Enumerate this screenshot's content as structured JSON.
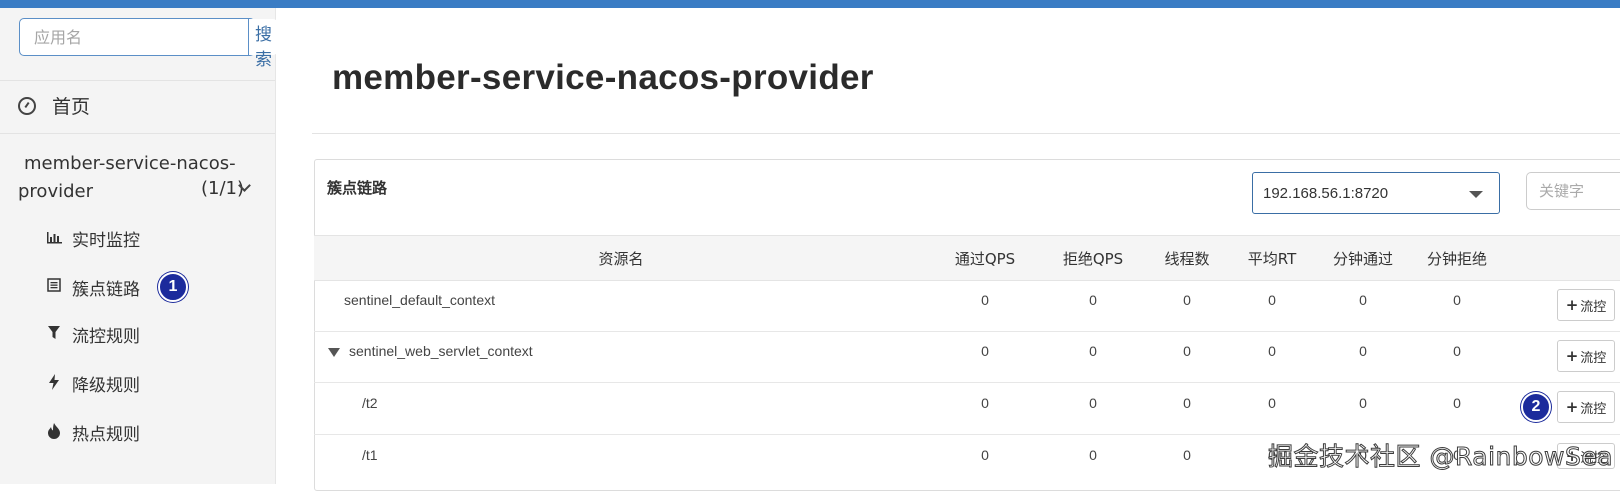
{
  "sidebar": {
    "search": {
      "placeholder": "应用名",
      "button": "搜索"
    },
    "home": "首页",
    "app": {
      "name_line1": "member-service-nacos-",
      "name_line2": "provider",
      "count": "(1/1)"
    },
    "menu": [
      {
        "label": "实时监控",
        "icon": "bar-chart-icon"
      },
      {
        "label": "簇点链路",
        "icon": "list-icon",
        "badge": "1"
      },
      {
        "label": "流控规则",
        "icon": "filter-icon"
      },
      {
        "label": "降级规则",
        "icon": "bolt-icon"
      },
      {
        "label": "热点规则",
        "icon": "fire-icon"
      }
    ]
  },
  "main": {
    "title": "member-service-nacos-provider",
    "panel": {
      "title": "簇点链路",
      "machine": "192.168.56.1:8720",
      "keyword_placeholder": "关键字"
    },
    "table": {
      "columns": [
        "资源名",
        "通过QPS",
        "拒绝QPS",
        "线程数",
        "平均RT",
        "分钟通过",
        "分钟拒绝"
      ],
      "action_label": "流控",
      "rows": [
        {
          "resource": "sentinel_default_context",
          "values": [
            "0",
            "0",
            "0",
            "0",
            "0",
            "0"
          ],
          "expand": false
        },
        {
          "resource": "sentinel_web_servlet_context",
          "values": [
            "0",
            "0",
            "0",
            "0",
            "0",
            "0"
          ],
          "expand": true
        },
        {
          "resource": "/t2",
          "values": [
            "0",
            "0",
            "0",
            "0",
            "0",
            "0"
          ],
          "badge": "2"
        },
        {
          "resource": "/t1",
          "values": [
            "0",
            "0",
            "0",
            "0",
            "0",
            "0"
          ]
        }
      ]
    }
  },
  "watermark": "掘金技术社区 @RainbowSea",
  "colors": {
    "topbar": "#3a7cc4",
    "badge": "#1c2b9c",
    "accent": "#3a6ea5"
  }
}
